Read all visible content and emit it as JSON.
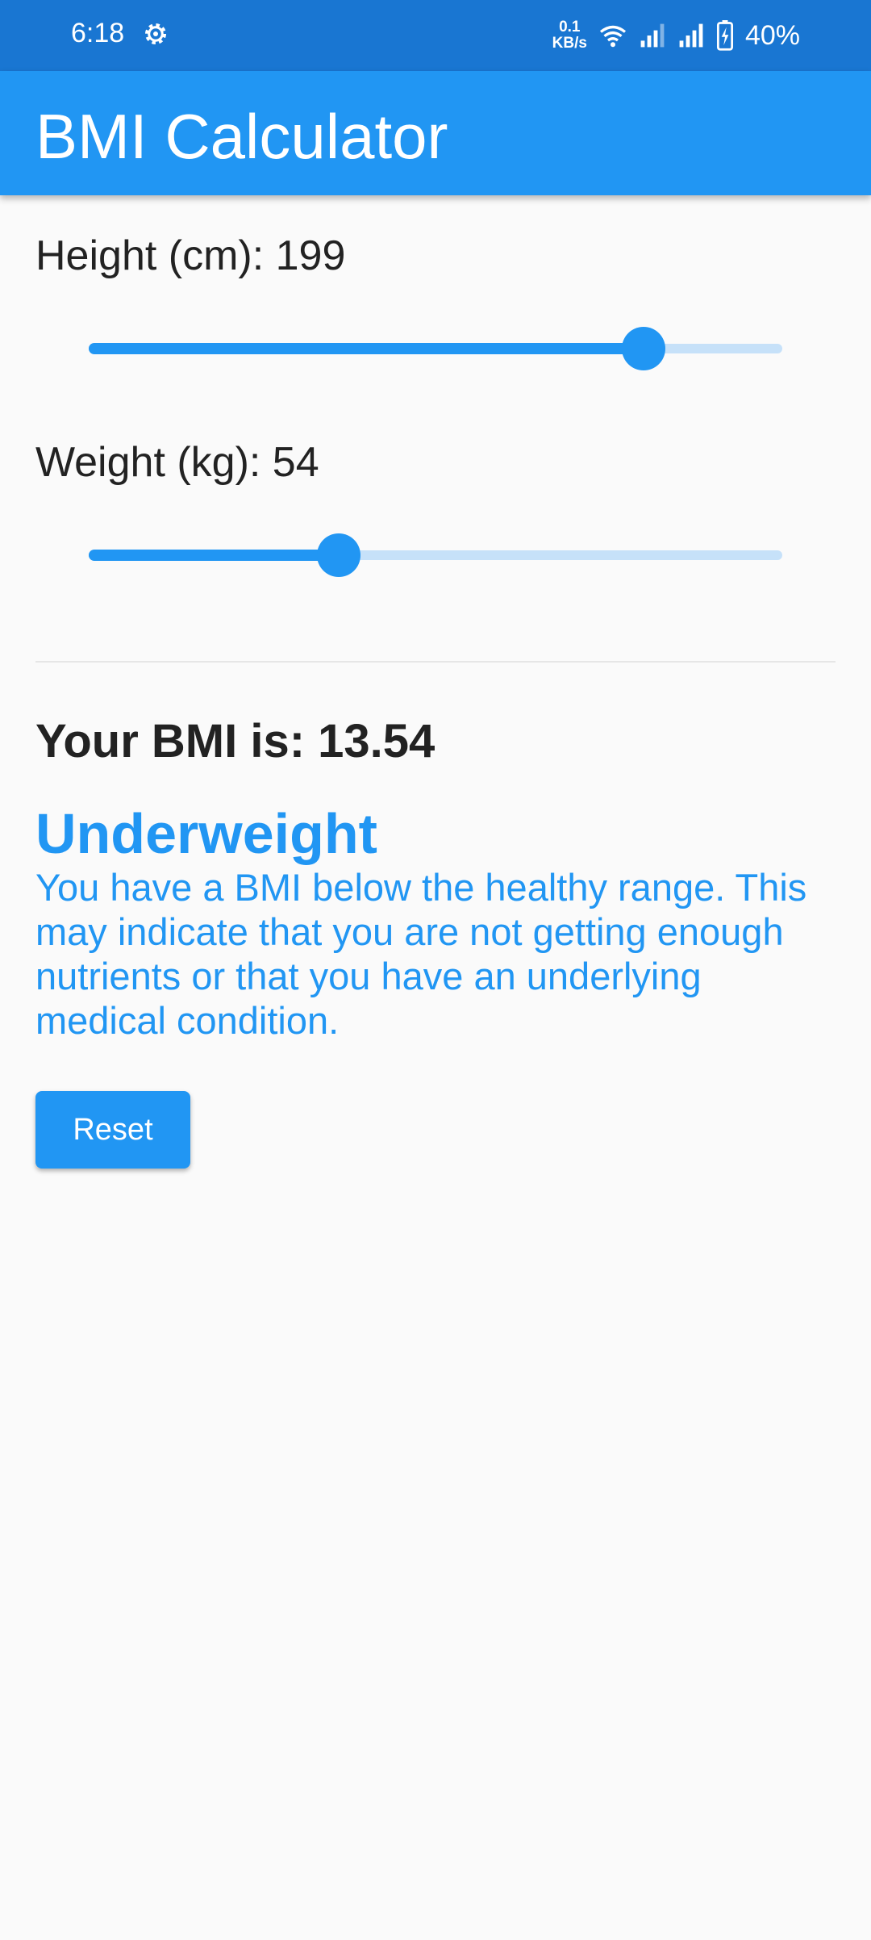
{
  "status_bar": {
    "time": "6:18",
    "speed_value": "0.1",
    "speed_unit": "KB/s",
    "battery": "40%",
    "icons": [
      "settings-gear-icon",
      "wifi-icon",
      "signal-icon",
      "signal-icon",
      "battery-charging-icon"
    ]
  },
  "app_bar": {
    "title": "BMI Calculator"
  },
  "height": {
    "label": "Height (cm): 199",
    "value": 199,
    "fraction": 0.8
  },
  "weight": {
    "label": "Weight (kg): 54",
    "value": 54,
    "fraction": 0.36
  },
  "result": {
    "bmi_text": "Your BMI is: 13.54",
    "category": "Underweight",
    "description": "You have a BMI below the healthy range. This may indicate that you are not getting enough nutrients or that you have an underlying medical condition."
  },
  "actions": {
    "reset_label": "Reset"
  },
  "colors": {
    "primary": "#2196f3",
    "status_bar": "#1976d2",
    "track": "#c6e1f9",
    "background": "#fafafa"
  }
}
